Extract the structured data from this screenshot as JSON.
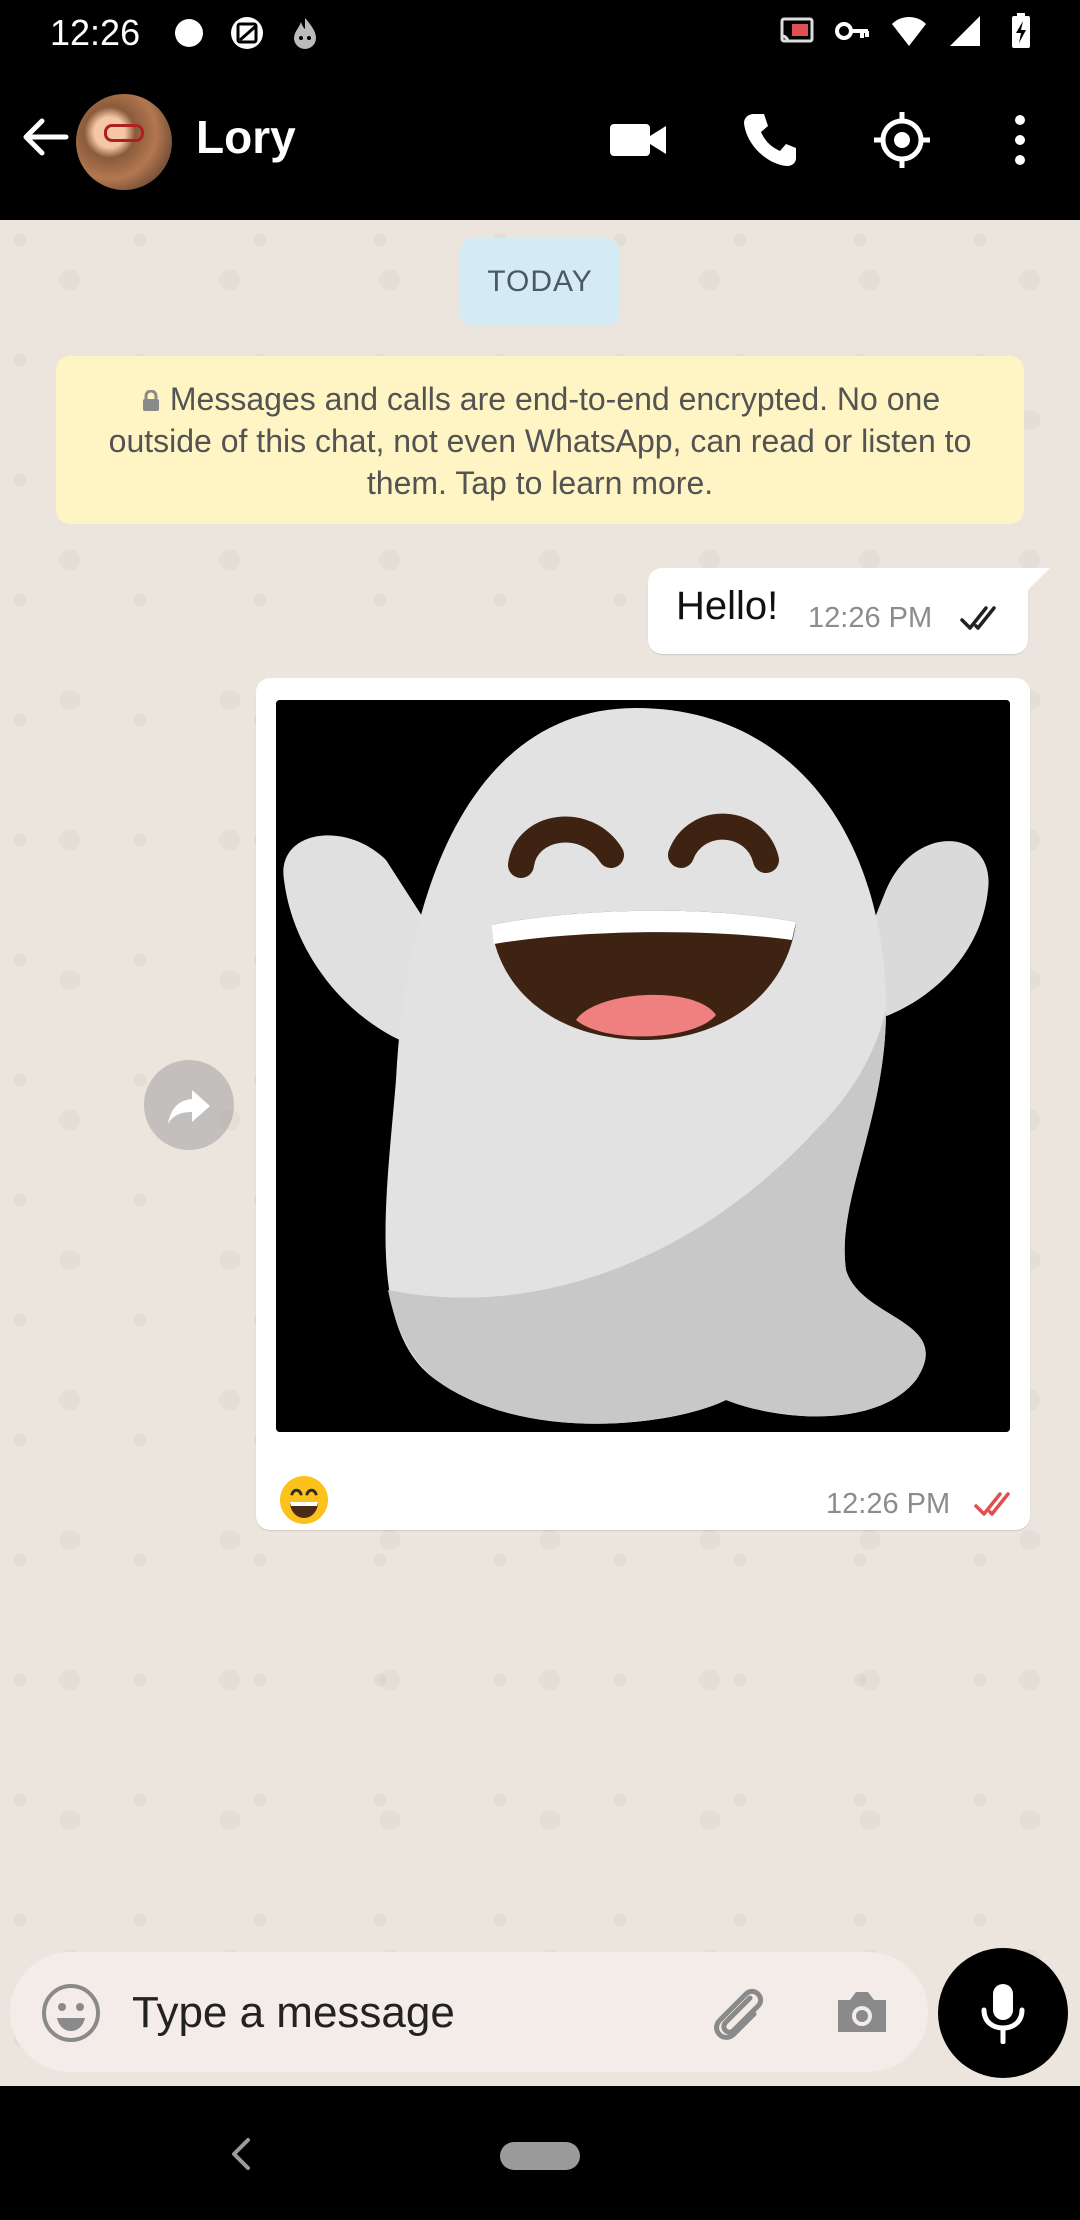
{
  "status_bar": {
    "time": "12:26",
    "left_icons": [
      "dot-icon",
      "image-icon",
      "flame-icon"
    ],
    "right_icons": [
      "cast-icon",
      "key-icon",
      "wifi-icon",
      "signal-icon",
      "battery-charging-icon"
    ]
  },
  "header": {
    "contact_name": "Lory",
    "actions": [
      "video-call-icon",
      "voice-call-icon",
      "location-icon",
      "more-options-icon"
    ]
  },
  "chat": {
    "date_chip": "TODAY",
    "encryption_notice": "Messages and calls are end-to-end encrypted. No one outside of this chat, not even WhatsApp, can read or listen to them. Tap to learn more.",
    "messages": [
      {
        "type": "text",
        "text": "Hello!",
        "time": "12:26 PM",
        "status": "delivered"
      },
      {
        "type": "image",
        "caption_emoji": "😄",
        "time": "12:26 PM",
        "status": "read"
      }
    ]
  },
  "composer": {
    "placeholder": "Type a message",
    "value": ""
  },
  "colors": {
    "chat_background": "#ece5dd",
    "encryption_bg": "#fff5c4",
    "date_chip_bg": "#d4eaf4",
    "read_ticks": "#e05050"
  }
}
